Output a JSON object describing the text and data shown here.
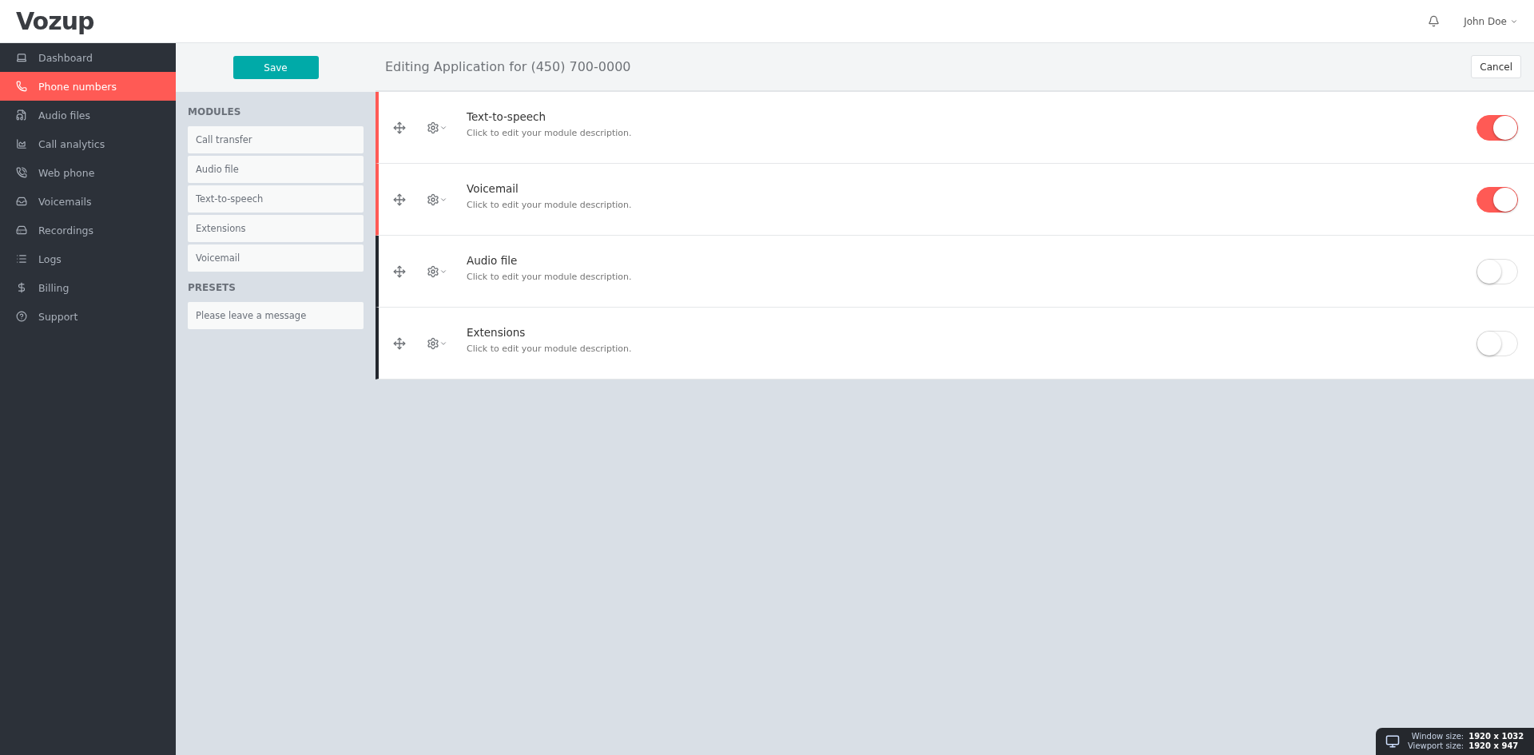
{
  "header": {
    "logo": "Vozup",
    "user": "John Doe"
  },
  "sidebar": {
    "items": [
      {
        "label": "Dashboard",
        "selected": false
      },
      {
        "label": "Phone numbers",
        "selected": true
      },
      {
        "label": "Audio files",
        "selected": false
      },
      {
        "label": "Call analytics",
        "selected": false
      },
      {
        "label": "Web phone",
        "selected": false
      },
      {
        "label": "Voicemails",
        "selected": false
      },
      {
        "label": "Recordings",
        "selected": false
      },
      {
        "label": "Logs",
        "selected": false
      },
      {
        "label": "Billing",
        "selected": false
      },
      {
        "label": "Support",
        "selected": false
      }
    ]
  },
  "palette": {
    "save_button": "Save",
    "modules_heading": "MODULES",
    "modules": [
      "Call transfer",
      "Audio file",
      "Text-to-speech",
      "Extensions",
      "Voicemail"
    ],
    "presets_heading": "PRESETS",
    "presets": [
      "Please leave a message"
    ]
  },
  "editor": {
    "title": "Editing Application for (450) 700-0000",
    "cancel_button": "Cancel",
    "modules": [
      {
        "name": "Text-to-speech",
        "description": "Click to edit your module description.",
        "on": true
      },
      {
        "name": "Voicemail",
        "description": "Click to edit your module description.",
        "on": true
      },
      {
        "name": "Audio file",
        "description": "Click to edit your module description.",
        "on": false
      },
      {
        "name": "Extensions",
        "description": "Click to edit your module description.",
        "on": false
      }
    ]
  },
  "size_badge": {
    "window_label": "Window size:",
    "window_value": "1920 x 1032",
    "viewport_label": "Viewport size:",
    "viewport_value": "1920 x 947"
  }
}
